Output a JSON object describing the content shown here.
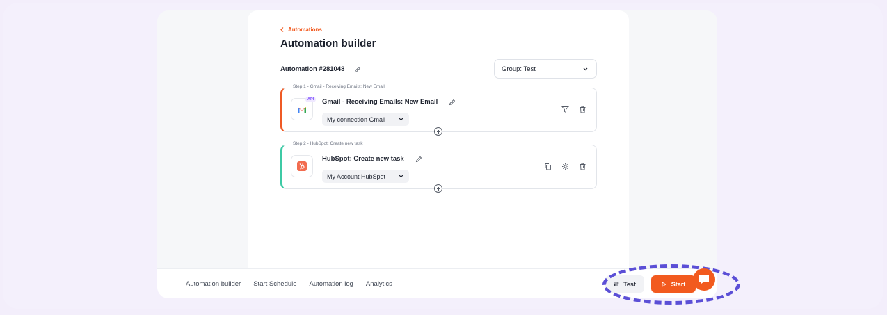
{
  "breadcrumb": {
    "back_label": "Automations"
  },
  "page": {
    "title": "Automation builder"
  },
  "automation": {
    "name": "Automation #281048"
  },
  "group_select": {
    "value": "Group: Test"
  },
  "steps": [
    {
      "legend": "Step 1 - Gmail - Receiving Emails: New Email",
      "title": "Gmail - Receiving Emails: New Email",
      "badge": "API",
      "connection": "My connection Gmail",
      "accent": "#ef5a25",
      "icon": "gmail-icon",
      "actions": [
        "filter-icon",
        "trash-icon"
      ]
    },
    {
      "legend": "Step 2 - HubSpot: Create new task",
      "title": "HubSpot: Create new task",
      "connection": "My Account HubSpot",
      "accent": "#3dcaa5",
      "icon": "hubspot-icon",
      "actions": [
        "copy-icon",
        "gear-icon",
        "trash-icon"
      ]
    }
  ],
  "footer": {
    "nav": [
      "Automation builder",
      "Start Schedule",
      "Automation log",
      "Analytics"
    ],
    "test_label": "Test",
    "start_label": "Start"
  },
  "colors": {
    "accent": "#f25a1f",
    "highlight": "#5b4fd6",
    "background": "#f3eefb"
  }
}
